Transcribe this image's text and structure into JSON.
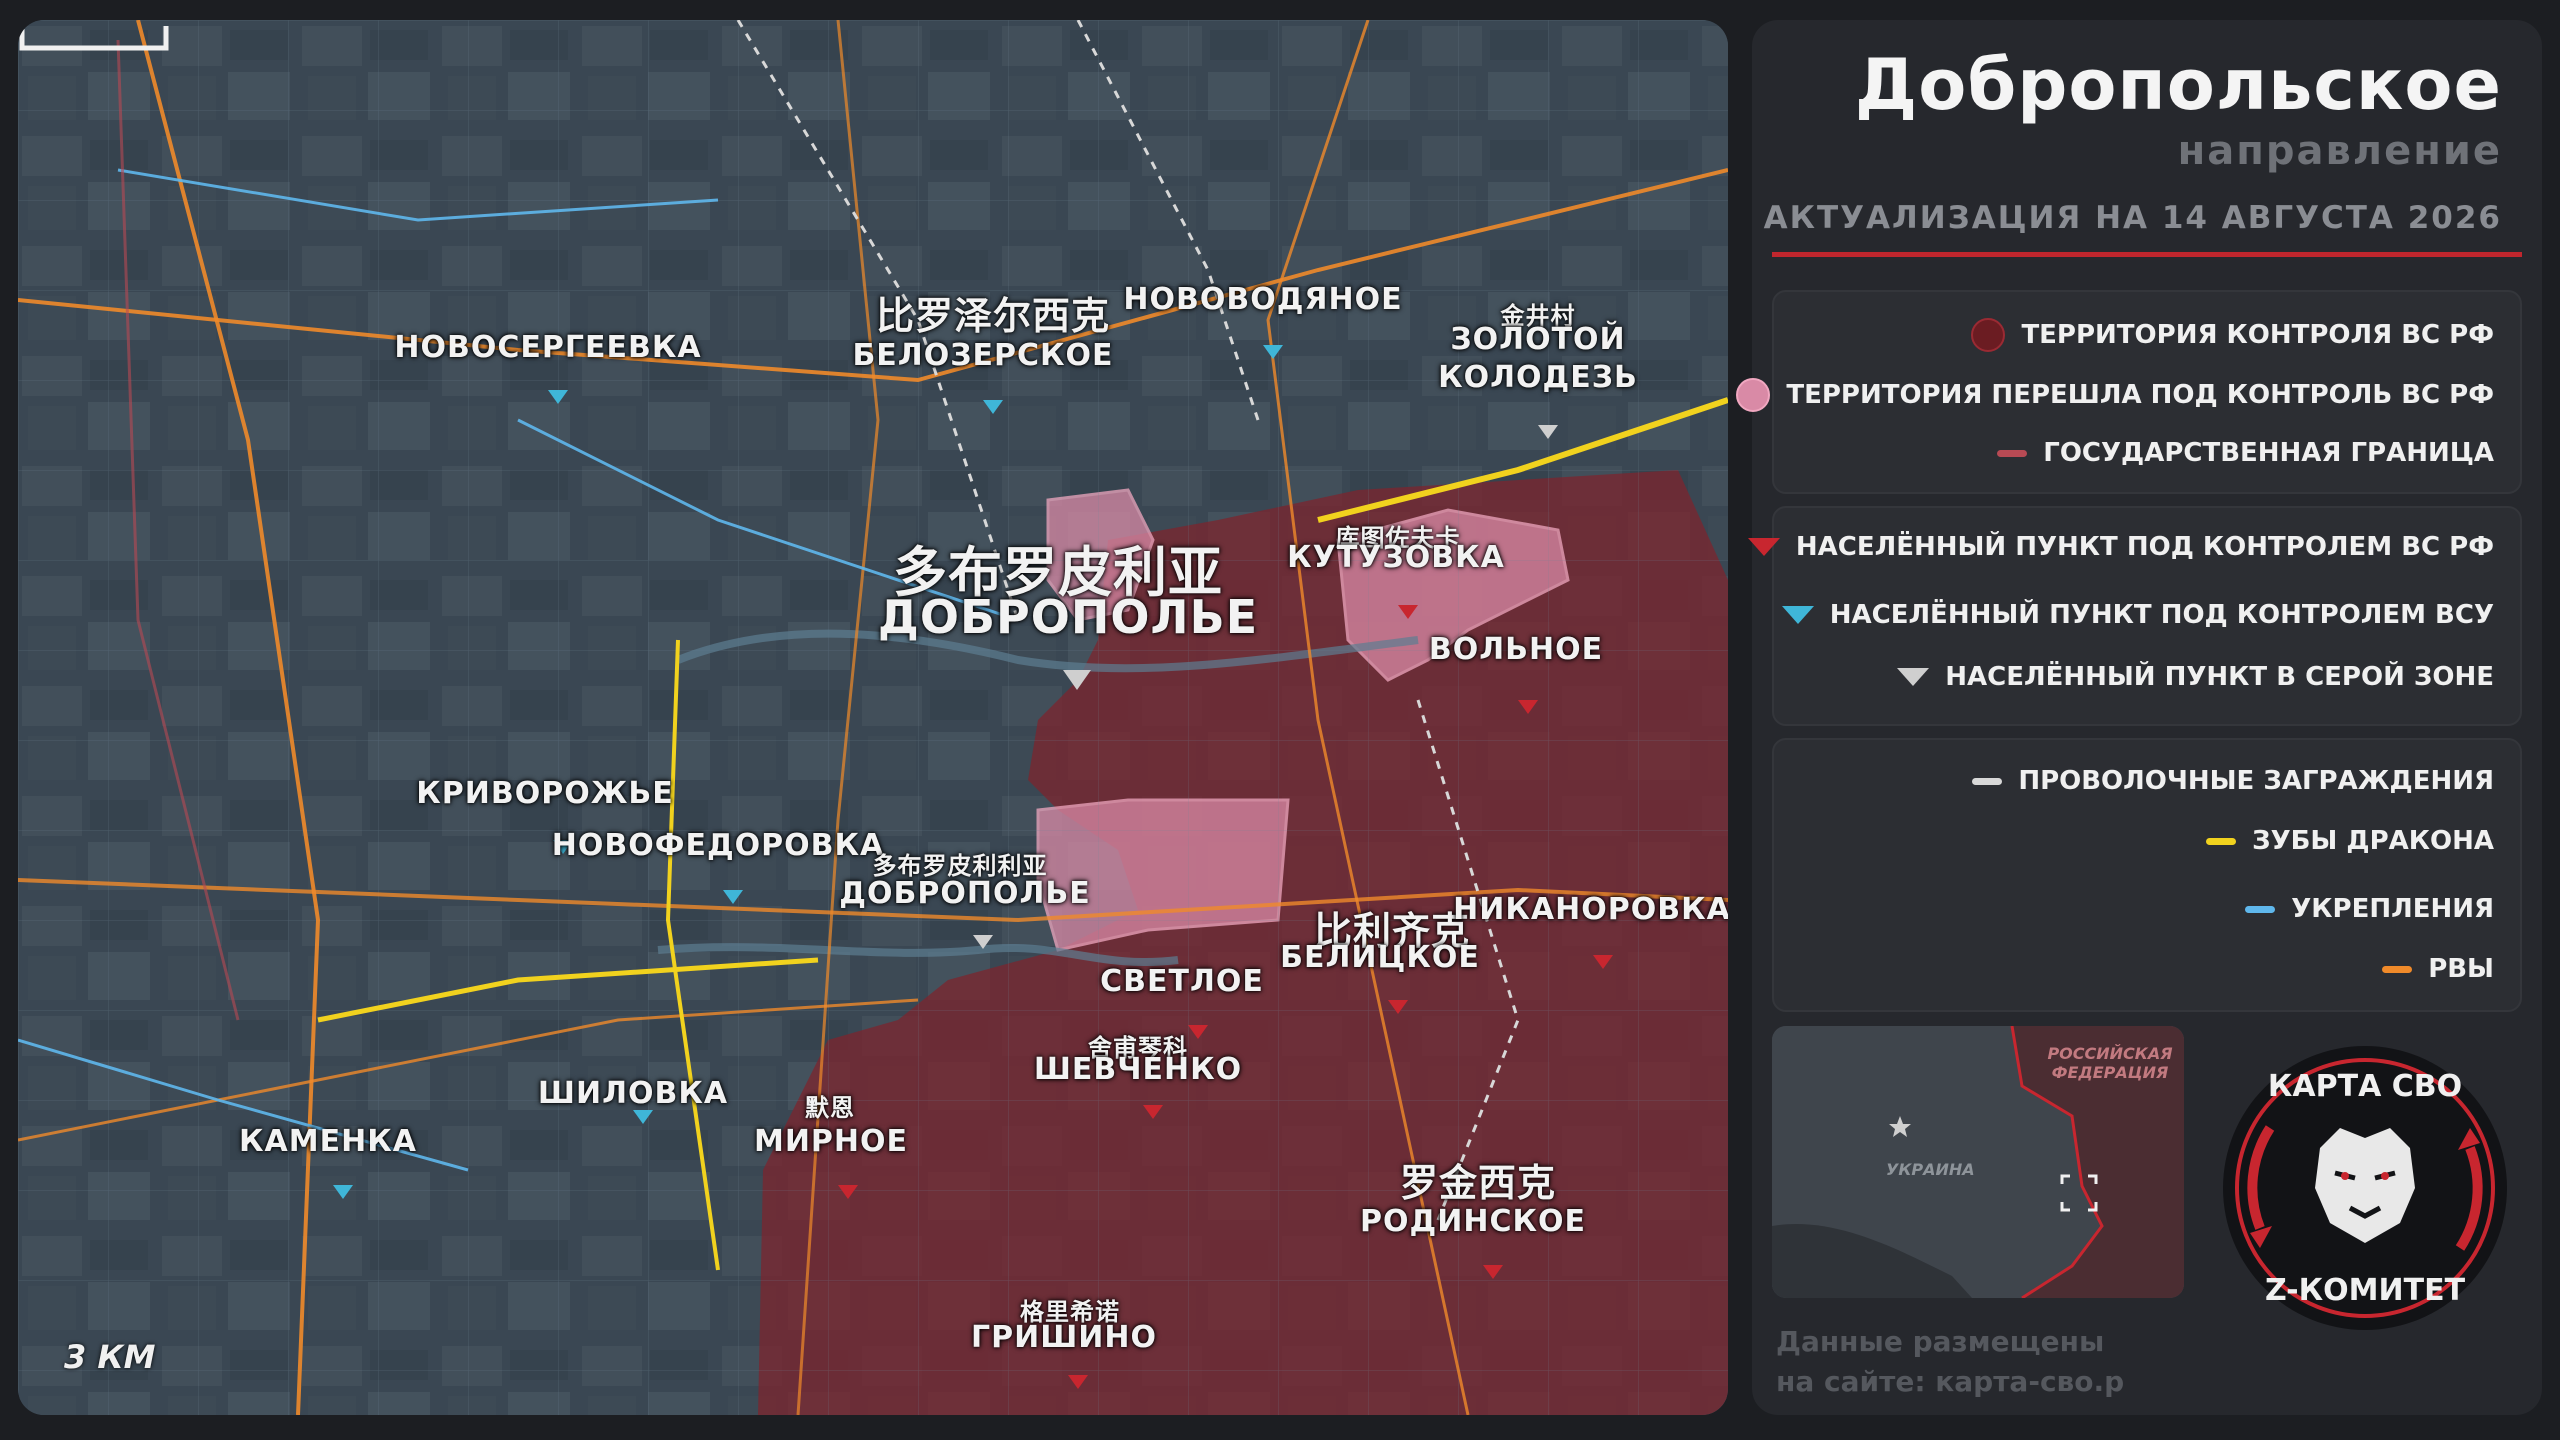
{
  "panel": {
    "title": "Добропольское",
    "subtitle": "направление",
    "update": "АКТУАЛИЗАЦИЯ НА 14 АВГУСТА 2026",
    "legend_territory": [
      {
        "label": "ТЕРРИТОРИЯ КОНТРОЛЯ ВС РФ",
        "color": "#6b1c22",
        "symbol": "circle"
      },
      {
        "label": "ТЕРРИТОРИЯ ПЕРЕШЛА ПОД КОНТРОЛЬ ВС РФ",
        "color": "#d98aa6",
        "symbol": "circle"
      },
      {
        "label": "ГОСУДАРСТВЕННАЯ ГРАНИЦА",
        "color": "#b84a54",
        "symbol": "line"
      }
    ],
    "legend_settlements": [
      {
        "label": "НАСЕЛЁННЫЙ ПУНКТ ПОД КОНТРОЛЕМ ВС РФ",
        "color": "#c8262f"
      },
      {
        "label": "НАСЕЛЁННЫЙ ПУНКТ ПОД КОНТРОЛЕМ ВСУ",
        "color": "#3fb6d8"
      },
      {
        "label": "НАСЕЛЁННЫЙ ПУНКТ В СЕРОЙ ЗОНЕ",
        "color": "#cfcfcf"
      }
    ],
    "legend_fortifications": [
      {
        "label": "ПРОВОЛОЧНЫЕ ЗАГРАЖДЕНИЯ",
        "color": "#d8d8d8"
      },
      {
        "label": "ЗУБЫ ДРАКОНА",
        "color": "#f1d21e"
      },
      {
        "label": "УКРЕПЛЕНИЯ",
        "color": "#5fb7ec"
      },
      {
        "label": "РВЫ",
        "color": "#f08a2a"
      }
    ],
    "minimap": {
      "russia": "РОССИЙСКАЯ ФЕДЕРАЦИЯ",
      "ukraine": "УКРАИНА"
    },
    "footer_line1": "Данные размещены",
    "footer_line2": "на сайте: карта-сво.р",
    "logo_top": "КАРТА СВО",
    "logo_bottom": "Z-КОМИТЕТ"
  },
  "map": {
    "scale": "3 КМ",
    "labels": {
      "novosergeevka": "НОВОСЕРГЕЕВКА",
      "belozerskoe_cn": "比罗泽尔西克",
      "belozerskoe": "БЕЛОЗЕРСКОЕ",
      "novovodyanoe": "НОВОВОДЯНОЕ",
      "zolotoy_cn": "金井村",
      "zolotoy1": "ЗОЛОТОЙ",
      "zolotoy2": "КОЛОДЕЗЬ",
      "kutuzovka_cn": "库图佐夫卡",
      "kutuzovka": "КУТУЗОВКА",
      "dobropolye_big_cn": "多布罗皮利亚",
      "dobropolye_big": "ДОБРОПОЛЬЕ",
      "volnoe": "ВОЛЬНОЕ",
      "krivorozhye": "КРИВОРОЖЬЕ",
      "novofedorovka": "НОВОФЕДОРОВКА",
      "dobropolye_small_cn": "多布罗皮利利亚",
      "dobropolye_small": "ДОБРОПОЛЬЕ",
      "belitskoe_cn": "比利齐克",
      "belitskoe": "БЕЛИЦКОЕ",
      "nikanorovka": "НИКАНОРОВКА",
      "svetloe": "СВЕТЛОЕ",
      "shevchenko_cn": "舍甫琴科",
      "shevchenko": "ШЕВЧЕНКО",
      "shilovka": "ШИЛОВКА",
      "kamenka": "КАМЕНКА",
      "mirnoe_cn": "默恩",
      "mirnoe": "МИРНОЕ",
      "rodinskoe_cn": "罗金西克",
      "rodinskoe": "РОДИНСКОЕ",
      "grishino_cn": "格里希诺",
      "grishino": "ГРИШИНО"
    }
  }
}
